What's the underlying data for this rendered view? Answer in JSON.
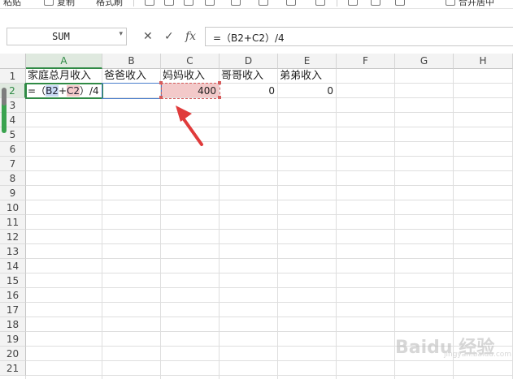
{
  "toolbar": {
    "items": [
      "粘贴",
      "复制",
      "格式刷",
      "合并居中"
    ]
  },
  "formula_bar": {
    "name_box": "SUM",
    "cancel_icon": "✕",
    "confirm_icon": "✓",
    "fx_label": "fx",
    "formula": "=（B2+C2）/4"
  },
  "columns": [
    "A",
    "B",
    "C",
    "D",
    "E",
    "F",
    "G",
    "H"
  ],
  "active_column": "A",
  "rows": [
    "1",
    "2",
    "3",
    "4",
    "5",
    "6",
    "7",
    "8",
    "9",
    "10",
    "11",
    "12",
    "13",
    "14",
    "15",
    "16",
    "17",
    "18",
    "19",
    "20",
    "21"
  ],
  "active_row": "2",
  "cells": {
    "A1": "家庭总月收入",
    "B1": "爸爸收入",
    "C1": "妈妈收入",
    "D1": "哥哥收入",
    "E1": "弟弟收入",
    "A2_parts": [
      "=（",
      "B2",
      "+",
      "C2",
      "）/4"
    ],
    "C2": "400",
    "D2": "0",
    "E2": "0"
  },
  "colors": {
    "accent_green": "#2f8a45",
    "ref_blue": "#4a7ecc",
    "ref_red": "#d65b5b",
    "arrow_red": "#e03b3b"
  },
  "icons": {
    "arrow": "red-arrow-pointer",
    "watermark": "baidu-jingyan-logo"
  },
  "watermark": {
    "brand": "Baidu",
    "jingyan": "经验",
    "sub": "jingyan.baidu.com"
  }
}
